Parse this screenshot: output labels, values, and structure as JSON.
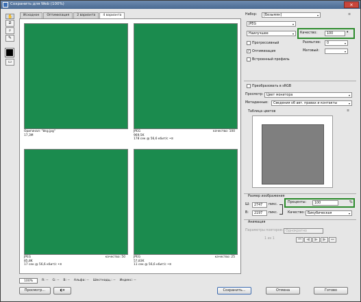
{
  "window": {
    "title": "Сохранить для Web (100%)",
    "close": "✕"
  },
  "tabs": [
    {
      "label": "Исходное"
    },
    {
      "label": "Оптимизация"
    },
    {
      "label": "2 варианта"
    },
    {
      "label": "4 варианта"
    }
  ],
  "panes": [
    {
      "line1": "Оригинал: \"bkg.jpg\"",
      "line2": "17,3M",
      "line3": "",
      "right": ""
    },
    {
      "line1": "JPEG",
      "line2": "969,5K",
      "line3": "178 сек @ 56,6 кбит/с  •≡",
      "right": "качество: 100"
    },
    {
      "line1": "JPEG",
      "line2": "85,8K",
      "line3": "17 сек @ 56,6 кбит/с  •≡",
      "right": "качество: 50"
    },
    {
      "line1": "JPEG",
      "line2": "57,83K",
      "line3": "11 сек @ 56,6 кбит/с  •≡",
      "right": "качество: 25"
    }
  ],
  "status": {
    "zoom": "100%",
    "r": "R: --",
    "g": "G: --",
    "b": "B: --",
    "alpha": "Альфа: --",
    "hex": "Шестнадц.: --",
    "index": "Индекс: --"
  },
  "settings": {
    "preset_label": "Набор:",
    "preset_value": "[Безымян]",
    "format": "JPEG",
    "compression": "Наилучшее",
    "quality_label": "Качество:",
    "quality_value": "100",
    "progressive": "Прогрессивный",
    "blur_label": "Размытие:",
    "blur_value": "0",
    "optimized": "Оптимизация",
    "matte_label": "Матовый:",
    "embed_profile": "Встроенный профиль",
    "convert_srgb": "Преобразовать в sRGB",
    "preview_label": "Просмотр:",
    "preview_value": "Цвет монитора",
    "metadata_label": "Метаданные:",
    "metadata_value": "Сведения об авт. правах и контакты",
    "color_table_label": "Таблица цветов"
  },
  "image_size": {
    "title": "Размер изображения",
    "w_label": "Ш:",
    "w_value": "2747",
    "w_unit": "пикс.",
    "h_label": "В:",
    "h_value": "2197",
    "h_unit": "пикс.",
    "percent_label": "Проценты:",
    "percent_value": "100",
    "percent_unit": "%",
    "quality_label": "Качество:",
    "quality_value": "Бикубическая"
  },
  "animation": {
    "title": "Анимация",
    "loop_label": "Параметры повторов:",
    "loop_value": "Однократно",
    "frame": "1 из 1"
  },
  "buttons": {
    "preview": "Просмотр...",
    "save": "Сохранить...",
    "cancel": "Отмена",
    "done": "Готово"
  },
  "icons": {
    "close": "✕",
    "dropdown": "▾",
    "check": "✓",
    "menu": "≡",
    "hand": "✋",
    "slice": "⧄",
    "zoom": "⌕",
    "eyedrop": "✎",
    "toggle": "▭"
  }
}
